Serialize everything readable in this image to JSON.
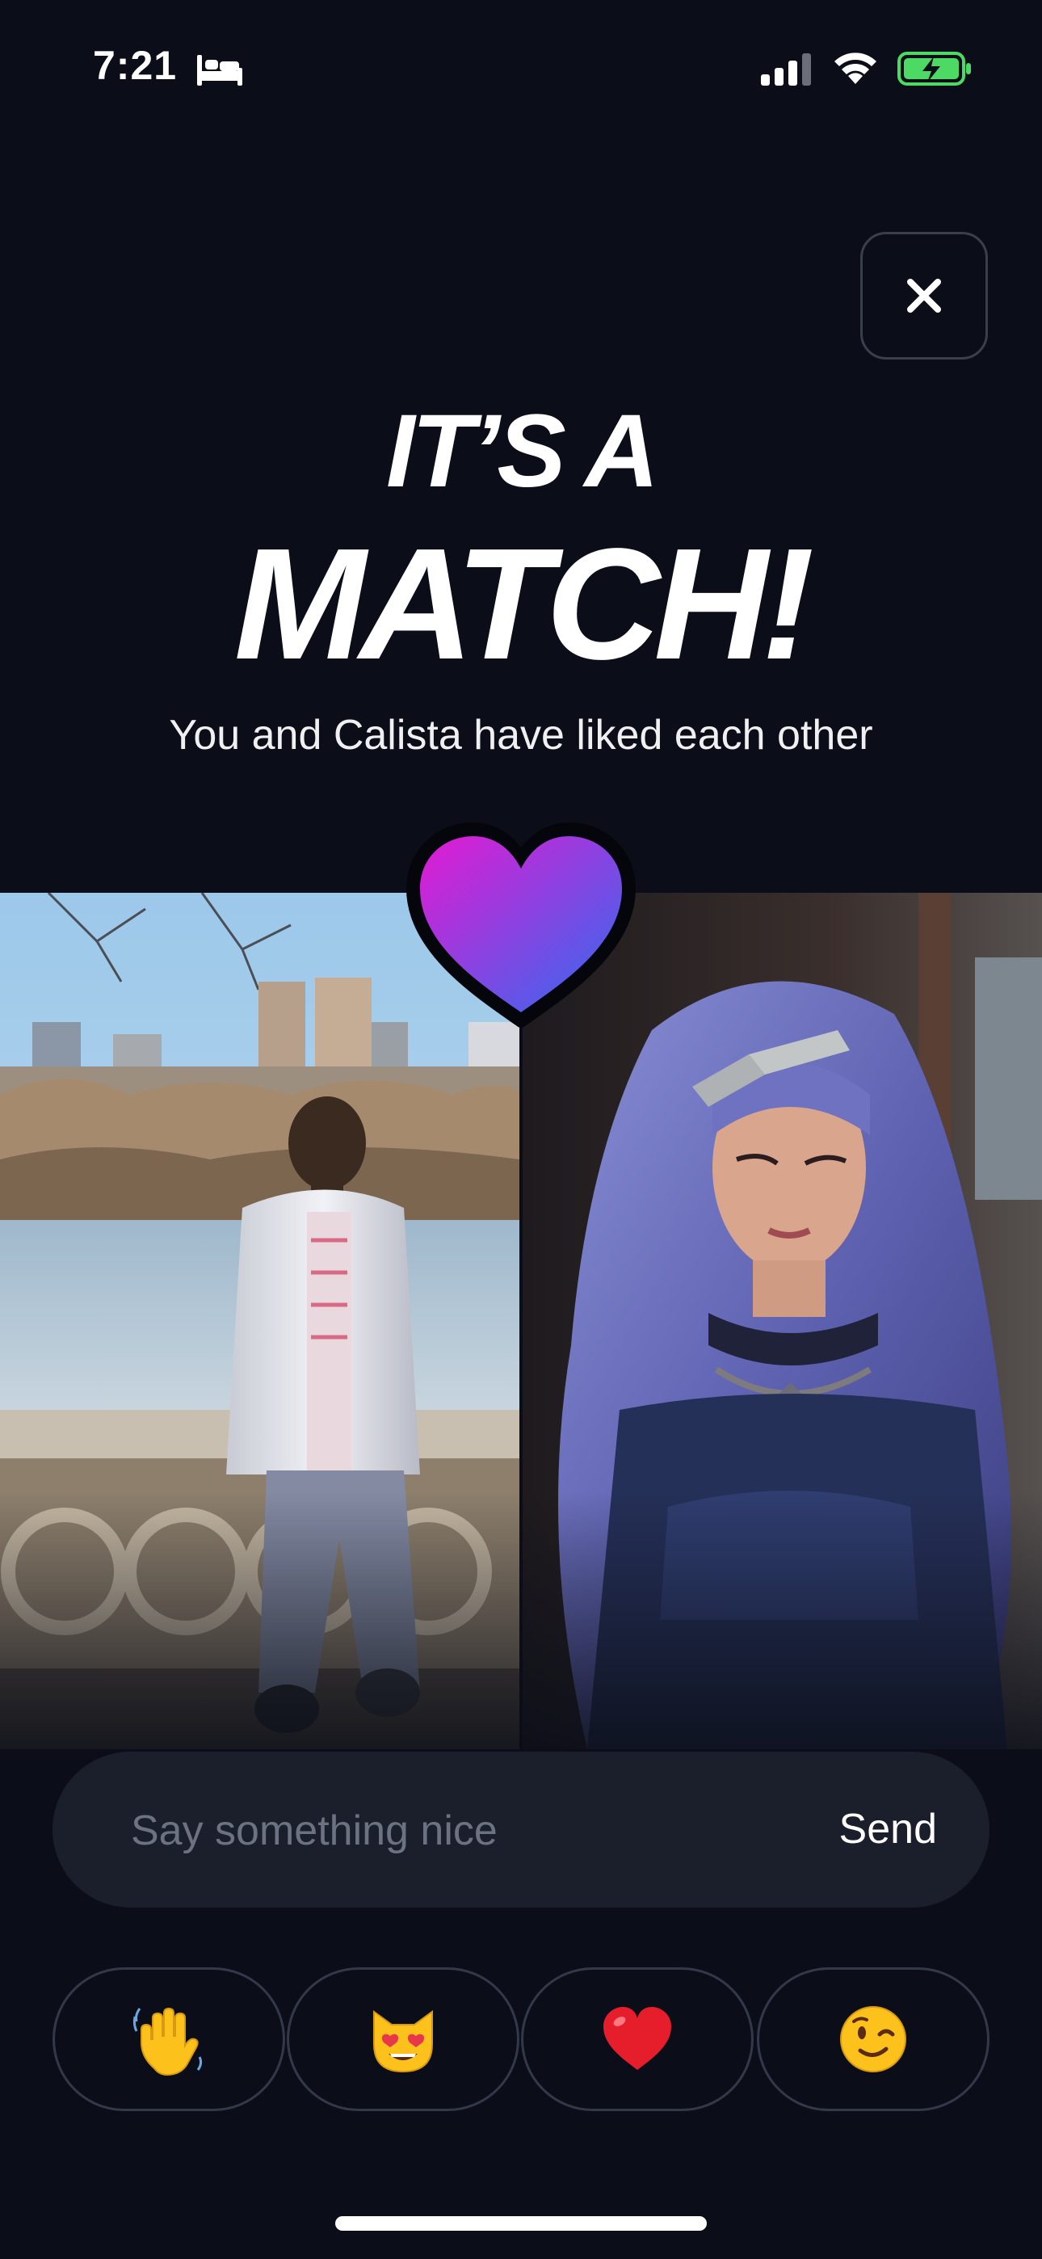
{
  "status_bar": {
    "time": "7:21",
    "icons": [
      "bed-icon",
      "cellular-signal-icon",
      "wifi-icon",
      "battery-charging-icon"
    ]
  },
  "close_button": {
    "icon": "close-icon"
  },
  "match": {
    "title_top": "IT’S A",
    "title_main": "MATCH!",
    "subtitle": "You and Calista have liked each other"
  },
  "photos": {
    "left": "user-photo",
    "right": "match-photo",
    "badge_icon": "heart-icon"
  },
  "message": {
    "placeholder": "Say something nice",
    "value": "",
    "send_label": "Send"
  },
  "quick_reactions": [
    {
      "icon": "waving-hand-emoji"
    },
    {
      "icon": "heart-eyes-cat-emoji"
    },
    {
      "icon": "red-heart-emoji"
    },
    {
      "icon": "winking-face-emoji"
    }
  ],
  "colors": {
    "background": "#0b0e18",
    "input_background": "#1b1f2b",
    "border": "#33384a",
    "heart_gradient_start": "#e31ad2",
    "heart_gradient_end": "#2f6cf0"
  }
}
